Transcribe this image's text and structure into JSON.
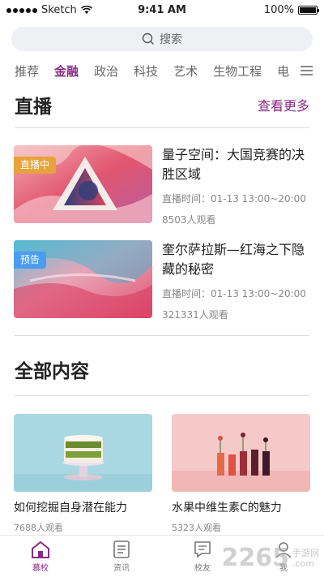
{
  "status_bar": {
    "carrier": "Sketch",
    "time": "9:41 AM",
    "battery": "100%"
  },
  "search": {
    "placeholder": "搜索"
  },
  "tabs": [
    {
      "label": "推荐",
      "active": false
    },
    {
      "label": "金融",
      "active": true
    },
    {
      "label": "政治",
      "active": false
    },
    {
      "label": "科技",
      "active": false
    },
    {
      "label": "艺术",
      "active": false
    },
    {
      "label": "生物工程",
      "active": false
    },
    {
      "label": "电",
      "active": false
    }
  ],
  "live": {
    "section_title": "直播",
    "more_label": "查看更多",
    "items": [
      {
        "badge": "直播中",
        "badge_color": "#e8a23a",
        "title": "量子空间：大国竞赛的决胜区域",
        "time": "直播时间：01-13 13:00~20:00",
        "count": "8503人观看"
      },
      {
        "badge": "预告",
        "badge_color": "#4a9df0",
        "title": "奎尔萨拉斯—红海之下隐藏的秘密",
        "time": "直播时间：01-13 13:00~20:00",
        "count": "321331人观看"
      }
    ]
  },
  "all": {
    "section_title": "全部内容",
    "items": [
      {
        "title": "如何挖掘自身潜在能力",
        "count": "7688人观看"
      },
      {
        "title": "水果中维生素C的魅力",
        "count": "5323人观看"
      }
    ]
  },
  "tabbar": [
    {
      "label": "慕校",
      "icon": "home-icon",
      "active": true
    },
    {
      "label": "资讯",
      "icon": "news-icon",
      "active": false
    },
    {
      "label": "校友",
      "icon": "chat-icon",
      "active": false
    },
    {
      "label": "我",
      "icon": "profile-icon",
      "active": false
    }
  ],
  "watermark": {
    "number": "2265",
    "site": ".com",
    "label": "手游网"
  },
  "colors": {
    "accent": "#8a2a86",
    "divider": "#dddddd"
  }
}
